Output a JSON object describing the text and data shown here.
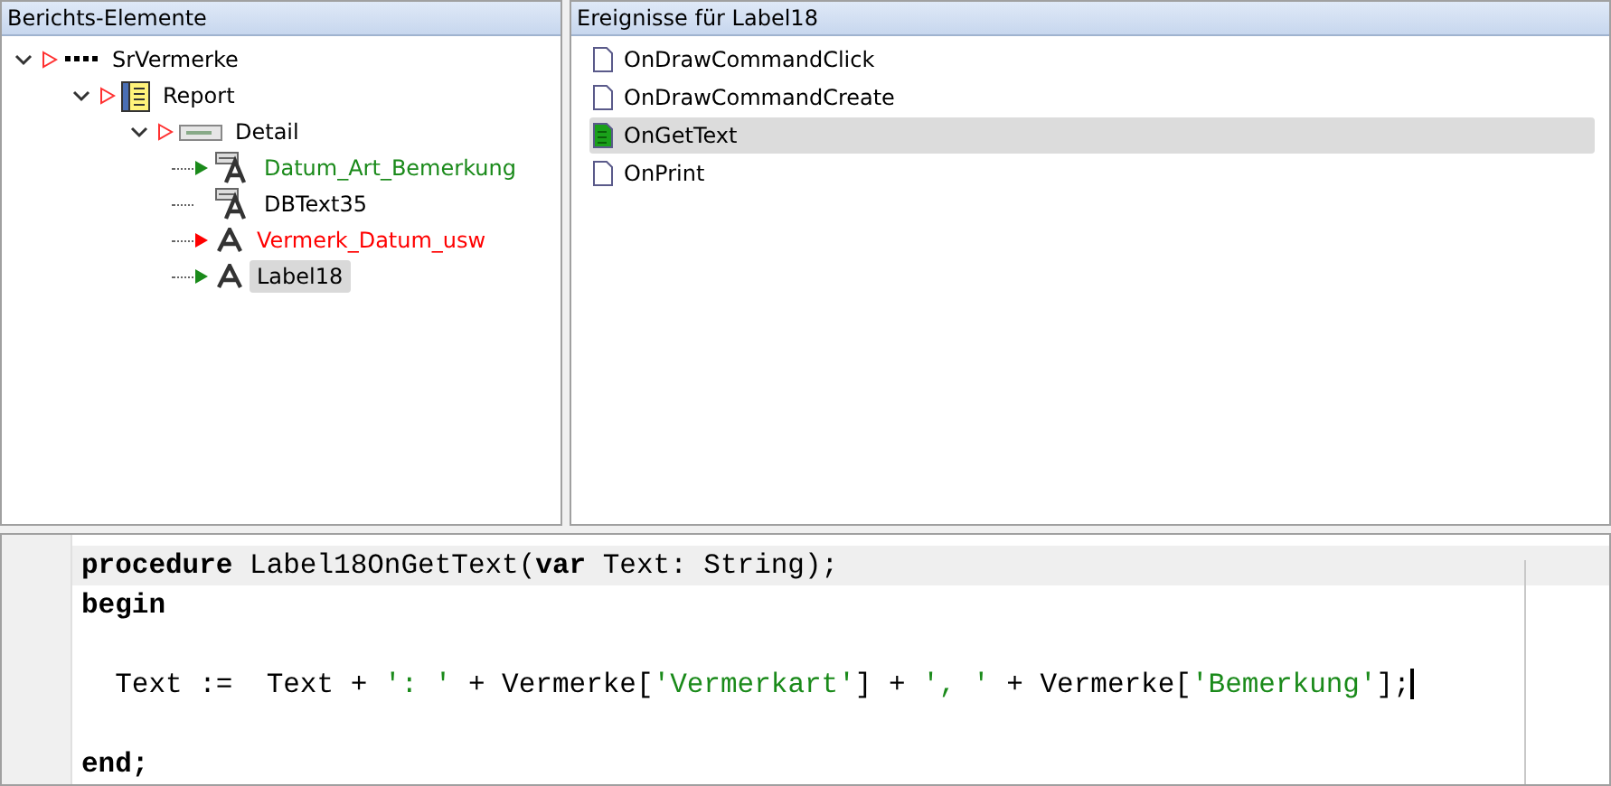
{
  "tree_panel": {
    "title": "Berichts-Elemente",
    "items": [
      {
        "label": "SrVermerke",
        "kind": "root",
        "marker": {
          "filled": false
        },
        "expanded": true,
        "selected": false,
        "children": [
          {
            "label": "Report",
            "kind": "report",
            "marker": {
              "filled": false
            },
            "expanded": true,
            "selected": false,
            "children": [
              {
                "label": "Detail",
                "kind": "band",
                "marker": {
                  "filled": false
                },
                "expanded": true,
                "selected": false,
                "children": [
                  {
                    "label": "Datum_Art_Bemerkung",
                    "kind": "dbtext",
                    "marker": {
                      "filled": true,
                      "color": "#1a8a1a"
                    },
                    "color": "#1a8a1a",
                    "selected": false
                  },
                  {
                    "label": "DBText35",
                    "kind": "dbtext",
                    "color": "#000000",
                    "selected": false
                  },
                  {
                    "label": "Vermerk_Datum_usw",
                    "kind": "label",
                    "marker": {
                      "filled": true,
                      "color": "#ff0000"
                    },
                    "color": "#ff0000",
                    "selected": false
                  },
                  {
                    "label": "Label18",
                    "kind": "label",
                    "marker": {
                      "filled": true,
                      "color": "#1a8a1a"
                    },
                    "color": "#000000",
                    "selected": true
                  }
                ]
              }
            ]
          }
        ]
      }
    ]
  },
  "events_panel": {
    "title": "Ereignisse für Label18",
    "items": [
      {
        "label": "OnDrawCommandClick",
        "has_code": false,
        "selected": false
      },
      {
        "label": "OnDrawCommandCreate",
        "has_code": false,
        "selected": false
      },
      {
        "label": "OnGetText",
        "has_code": true,
        "selected": true
      },
      {
        "label": "OnPrint",
        "has_code": false,
        "selected": false
      }
    ]
  },
  "editor": {
    "lines": [
      {
        "current": true,
        "tokens": [
          {
            "kind": "keyword",
            "text": "procedure"
          },
          {
            "kind": "plain",
            "text": " Label18OnGetText("
          },
          {
            "kind": "keyword",
            "text": "var"
          },
          {
            "kind": "plain",
            "text": " Text: String);"
          }
        ]
      },
      {
        "current": false,
        "tokens": [
          {
            "kind": "keyword",
            "text": "begin"
          }
        ]
      },
      {
        "current": false
      },
      {
        "current": false,
        "cursor": true,
        "tokens": [
          {
            "kind": "plain",
            "text": "  Text :=  Text + "
          },
          {
            "kind": "string",
            "text": "': '"
          },
          {
            "kind": "plain",
            "text": " + Vermerke["
          },
          {
            "kind": "string",
            "text": "'Vermerkart'"
          },
          {
            "kind": "plain",
            "text": "] + "
          },
          {
            "kind": "string",
            "text": "', '"
          },
          {
            "kind": "plain",
            "text": " + Vermerke["
          },
          {
            "kind": "string",
            "text": "'Bemerkung'"
          },
          {
            "kind": "plain",
            "text": "];"
          }
        ]
      },
      {
        "current": false
      },
      {
        "current": false,
        "tokens": [
          {
            "kind": "keyword",
            "text": "end;"
          }
        ]
      }
    ]
  }
}
